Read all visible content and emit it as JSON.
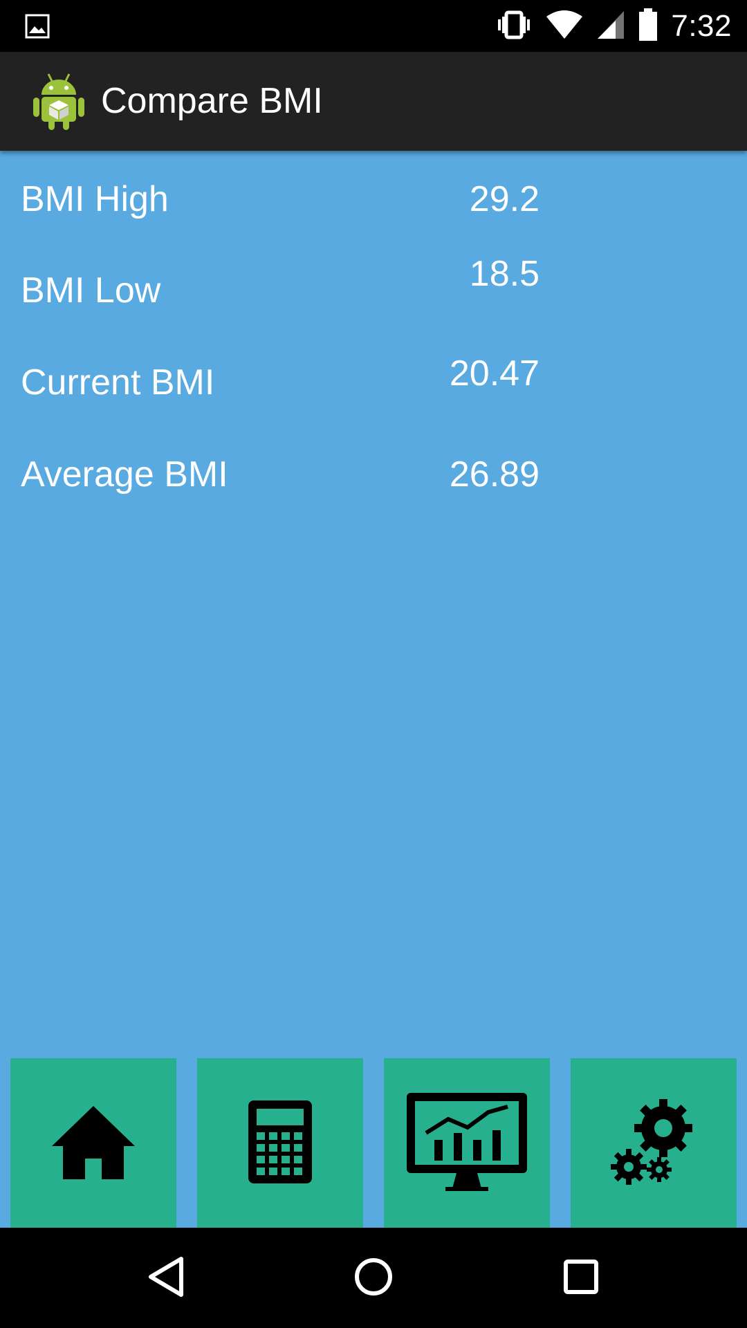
{
  "status_bar": {
    "time": "7:32",
    "icons": [
      "image-notification-icon",
      "vibrate-icon",
      "wifi-icon",
      "cell-signal-icon",
      "battery-icon"
    ]
  },
  "action_bar": {
    "title": "Compare BMI",
    "icon": "android-app-icon"
  },
  "rows": [
    {
      "label": "BMI High",
      "value": "29.2"
    },
    {
      "label": "BMI Low",
      "value": "18.5"
    },
    {
      "label": "Current BMI",
      "value": "20.47"
    },
    {
      "label": "Average BMI",
      "value": "26.89"
    }
  ],
  "bottom_nav": [
    {
      "name": "home",
      "icon": "home-icon"
    },
    {
      "name": "calculator",
      "icon": "calculator-icon"
    },
    {
      "name": "chart",
      "icon": "monitor-chart-icon"
    },
    {
      "name": "settings",
      "icon": "gears-icon"
    }
  ],
  "system_nav": [
    "back-icon",
    "home-circle-icon",
    "recents-icon"
  ],
  "colors": {
    "background": "#5aaae2",
    "tile": "#26b08e",
    "action_bar": "#222222",
    "status_bar": "#000000",
    "text": "#ffffff"
  }
}
